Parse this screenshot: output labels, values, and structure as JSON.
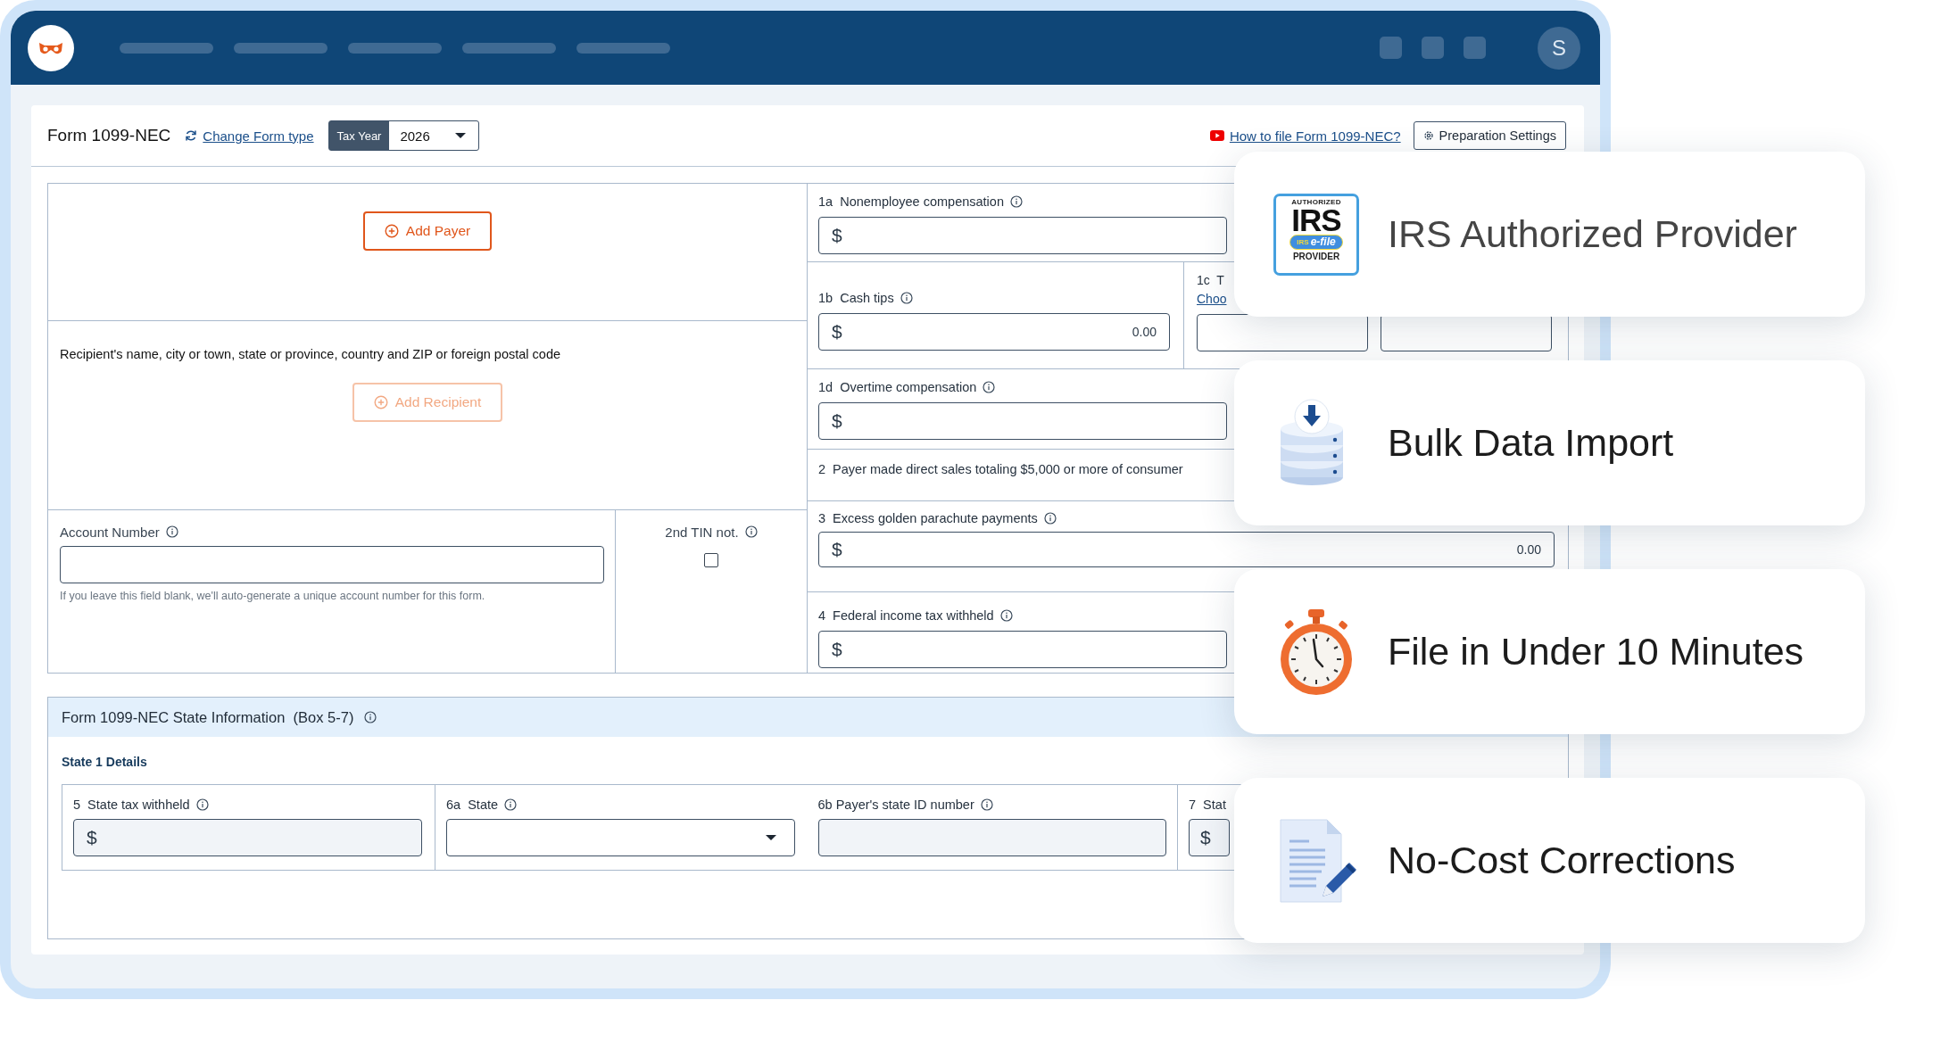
{
  "nav": {
    "avatar": "S"
  },
  "form_header": {
    "title": "Form 1099-NEC",
    "change_link": "Change Form type",
    "tax_year_label": "Tax Year",
    "tax_year": "2026",
    "help_link": "How to file Form 1099-NEC?",
    "settings_button": "Preparation Settings"
  },
  "payer": {
    "add_button": "Add Payer",
    "disabled": false
  },
  "recipient": {
    "label": "Recipient's name, city or town, state or province, country and ZIP or foreign postal code",
    "add_button": "Add Recipient",
    "disabled": true
  },
  "account": {
    "label": "Account Number",
    "info": true,
    "hint": "If you leave this field blank, we'll auto-generate a unique account number for this form."
  },
  "second_tin": {
    "label": "2nd TIN not.",
    "info": true,
    "checked": false
  },
  "boxes": [
    {
      "cells": [
        {
          "kind": "money",
          "label": "1a  Nonemployee compensation",
          "info": true,
          "currency": "$"
        }
      ]
    },
    {
      "cells": [
        {
          "kind": "money",
          "label": "1b  Cash tips",
          "info": true,
          "currency": "$",
          "value": "0.00"
        },
        {
          "kind": "choice",
          "label": "1c  T",
          "link": "Choo"
        }
      ]
    },
    {
      "cells": [
        {
          "kind": "money",
          "label": "1d  Overtime compensation",
          "info": true,
          "currency": "$"
        }
      ]
    },
    {
      "cells": [
        {
          "kind": "note",
          "label": "2  Payer made direct sales totaling $5,000 or more of consumer"
        }
      ]
    },
    {
      "cells": [
        {
          "kind": "money",
          "label": "3  Excess golden parachute payments",
          "info": true,
          "currency": "$",
          "value": "0.00"
        }
      ]
    },
    {
      "cells": [
        {
          "kind": "money",
          "label": "4  Federal income tax withheld",
          "info": true,
          "currency": "$"
        }
      ]
    }
  ],
  "state_info": {
    "title": "Form 1099-NEC State Information  (Box 5-7)",
    "info": true,
    "subtitle": "State 1 Details",
    "fields": [
      {
        "kind": "money",
        "label": "5  State tax withheld",
        "info": true,
        "currency": "$",
        "disabled": true
      },
      {
        "kind": "select",
        "label": "6a  State",
        "info": true,
        "disabled": false
      },
      {
        "kind": "text",
        "label": "6b Payer's state ID number",
        "info": true,
        "disabled": true
      },
      {
        "kind": "money",
        "label": "7  Stat",
        "currency": "$",
        "disabled": true
      }
    ]
  },
  "features": [
    {
      "kind": "irs",
      "title": "IRS Authorized Provider",
      "badge": {
        "top": "AUTHORIZED",
        "main": "IRS",
        "prefix": "IRS",
        "efile": "e-file",
        "bottom": "PROVIDER"
      }
    },
    {
      "kind": "database",
      "title": "Bulk Data Import"
    },
    {
      "kind": "stopwatch",
      "title": "File in Under 10 Minutes"
    },
    {
      "kind": "document",
      "title": "No-Cost Corrections"
    }
  ]
}
